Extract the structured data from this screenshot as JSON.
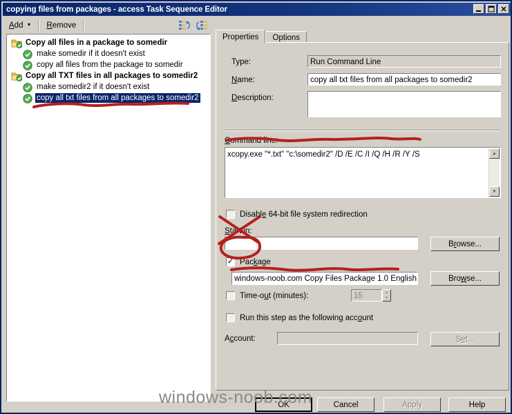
{
  "window": {
    "title": "copying files from packages - access Task Sequence Editor",
    "buttons": {
      "minimize": "minimize-icon",
      "maximize": "maximize-icon",
      "close": "close-icon"
    }
  },
  "toolbar": {
    "add_label": "Add",
    "add_caret": "▼",
    "remove_label": "Remove",
    "move_up_icon": "move-up-icon",
    "move_down_icon": "move-down-icon"
  },
  "tree": {
    "items": [
      {
        "label": "Copy all files in a package to somedir",
        "type": "group",
        "icon": "folder-check-icon",
        "selected": false
      },
      {
        "label": "make somedir if it doesn't exist",
        "type": "step",
        "icon": "green-check-icon",
        "selected": false
      },
      {
        "label": "copy all files from the package to somedir",
        "type": "step",
        "icon": "green-check-icon",
        "selected": false
      },
      {
        "label": "Copy all TXT files in all packages to somedir2",
        "type": "group",
        "icon": "folder-check-icon",
        "selected": false
      },
      {
        "label": "make somedir2 if it doesn't exist",
        "type": "step",
        "icon": "green-check-icon",
        "selected": false
      },
      {
        "label": "copy all txt files from all packages to somedir2",
        "type": "step",
        "icon": "green-check-icon",
        "selected": true
      }
    ]
  },
  "tabs": [
    {
      "label": "Properties",
      "active": true
    },
    {
      "label": "Options",
      "active": false
    }
  ],
  "properties": {
    "type_label": "Type:",
    "type_value": "Run Command Line",
    "name_label": "Name:",
    "name_value": "copy all txt files from all packages to somedir2",
    "description_label": "Description:",
    "description_value": "",
    "command_line_label": "Command line:",
    "command_line_value": "xcopy.exe \"*.txt\" \"c:\\somedir2\" /D /E /C /I /Q /H /R /Y /S",
    "disable_redirection_label": "Disable 64-bit file system redirection",
    "disable_redirection_checked": false,
    "start_in_label": "Start in:",
    "start_in_value": "",
    "start_in_browse_label": "Browse...",
    "package_label": "Package",
    "package_checked": true,
    "package_value": "windows-noob.com Copy Files Package 1.0 English",
    "package_browse_label": "Browse...",
    "timeout_label": "Time-out (minutes):",
    "timeout_checked": false,
    "timeout_value": "15",
    "run_as_label": "Run this step as the following account",
    "run_as_checked": false,
    "account_label": "Account:",
    "account_value": "",
    "account_set_label": "Set..."
  },
  "dialog_buttons": [
    {
      "label": "OK",
      "state": "default"
    },
    {
      "label": "Cancel",
      "state": "normal"
    },
    {
      "label": "Apply",
      "state": "disabled"
    },
    {
      "label": "Help",
      "state": "normal"
    }
  ],
  "watermark": {
    "text": "windows-noob.com"
  },
  "annotations": {
    "color": "#b52020",
    "marks": [
      "underline-tree-selected-item",
      "underline-command-line",
      "cross-out-start-in",
      "circle-package-checkbox",
      "underline-package-value"
    ]
  },
  "colors": {
    "title_bar": "#0a246a",
    "face": "#d4d0c8",
    "selection": "#0a246a",
    "annotation_red": "#b52020",
    "green_check": "#3c9a3c"
  }
}
